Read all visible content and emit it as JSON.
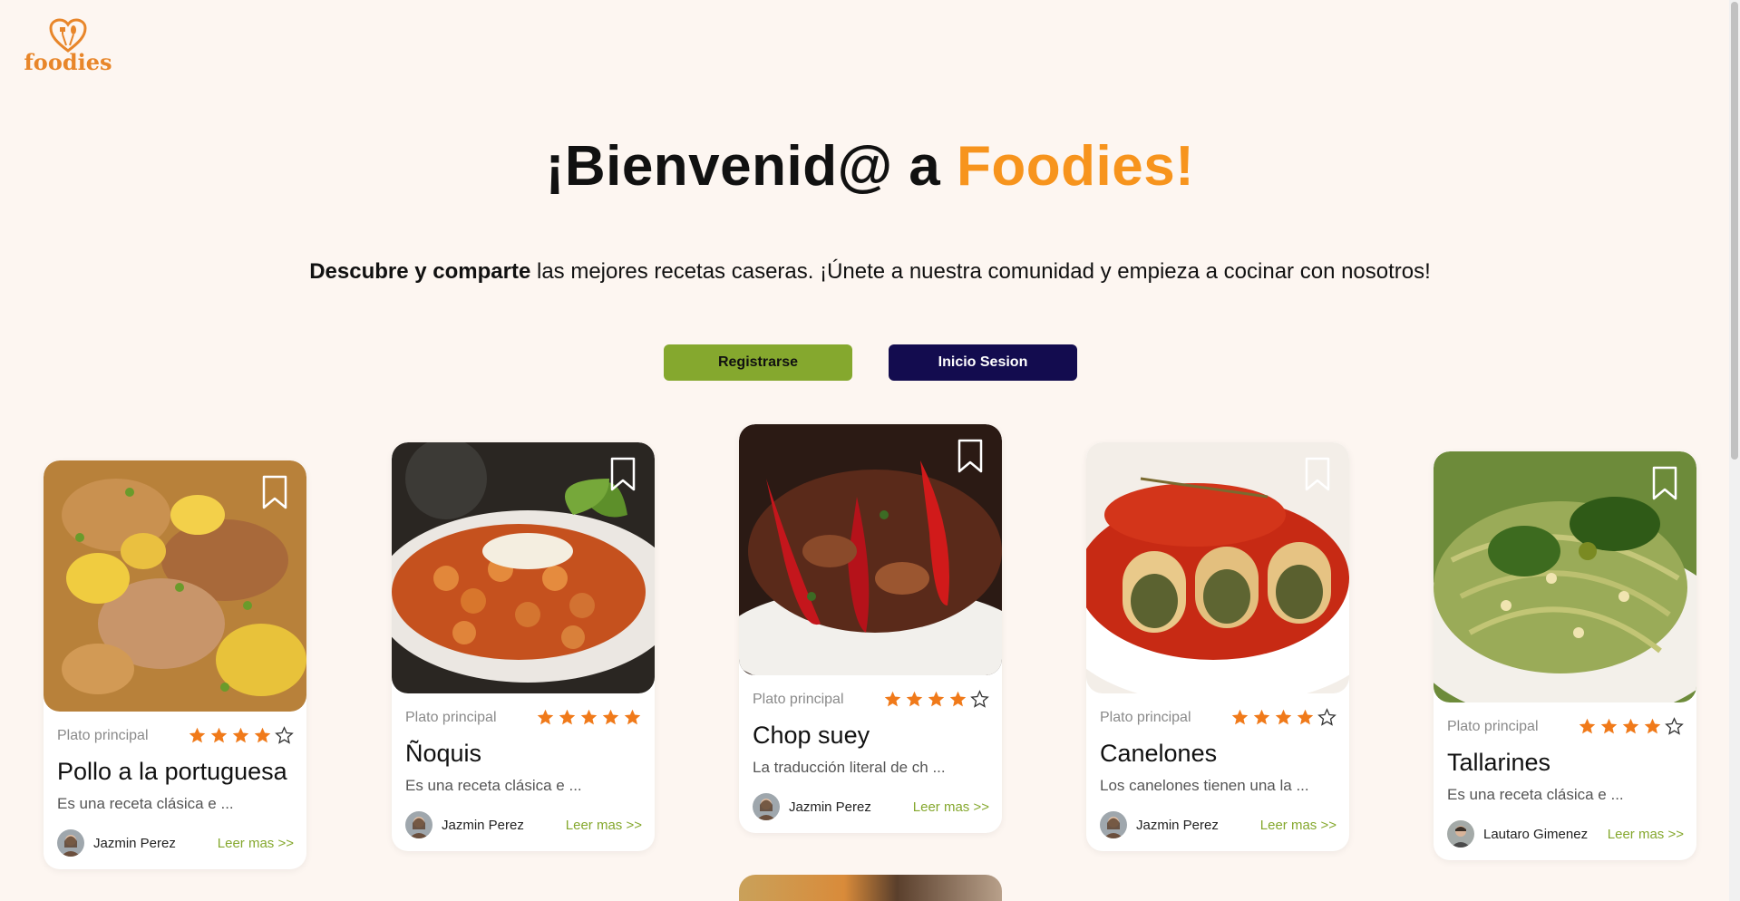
{
  "logo": {
    "text": "foodies"
  },
  "hero": {
    "title_prefix": "¡Bienvenid@ a ",
    "title_accent": "Foodies!",
    "subtitle_bold": "Descubre y comparte",
    "subtitle_rest": " las mejores recetas caseras. ¡Únete a nuestra comunidad y empieza a cocinar con nosotros!"
  },
  "buttons": {
    "register": "Registrarse",
    "login": "Inicio Sesion"
  },
  "colors": {
    "accent": "#f7941d",
    "green": "#85a82e",
    "navy": "#130c4f",
    "star": "#f07a1a"
  },
  "cards": [
    {
      "category": "Plato principal",
      "rating": 4,
      "title": "Pollo a la portuguesa",
      "desc": "Es una receta clásica e ...",
      "author": "Jazmin Perez",
      "read_more": "Leer mas >>"
    },
    {
      "category": "Plato principal",
      "rating": 5,
      "title": "Ñoquis",
      "desc": "Es una receta clásica e ...",
      "author": "Jazmin Perez",
      "read_more": "Leer mas >>"
    },
    {
      "category": "Plato principal",
      "rating": 4,
      "title": "Chop suey",
      "desc": "La traducción literal de ch ...",
      "author": "Jazmin Perez",
      "read_more": "Leer mas >>"
    },
    {
      "category": "Plato principal",
      "rating": 4,
      "title": "Canelones",
      "desc": "Los canelones tienen una la ...",
      "author": "Jazmin Perez",
      "read_more": "Leer mas >>"
    },
    {
      "category": "Plato principal",
      "rating": 4,
      "title": "Tallarines",
      "desc": "Es una receta clásica e ...",
      "author": "Lautaro Gimenez",
      "read_more": "Leer mas >>"
    }
  ]
}
